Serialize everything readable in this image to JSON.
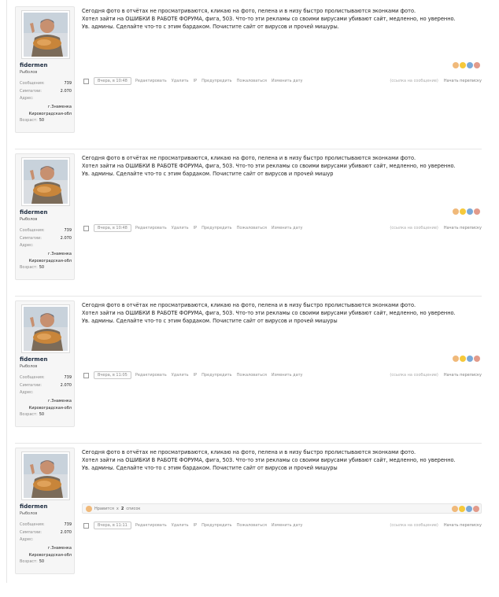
{
  "posts": [
    {
      "user": {
        "name": "fidermen",
        "title": "Рыболов",
        "messages_label": "Сообщения:",
        "messages": "739",
        "sympathy_label": "Симпатии:",
        "sympathy": "2.070",
        "address_label": "Адрес:",
        "address_line1": "г.Знаменка",
        "address_line2": "Кировоградская-обл",
        "age_label": "Возраст:",
        "age": "50"
      },
      "text": [
        "Сегодня фото в отчётах не просматриваются, кликаю на фото, пелена и в низу быстро пролистываются эконками фото.",
        "Хотел зайти на ОШИБКИ В РАБОТЕ ФОРУМА, фига, 503. Что-то эти рекламы со своими вирусами убивают сайт, медленно, но уверенно.",
        "Ув. админы. Сделайте что-то с этим бардаком. Почистите сайт от вирусов и прочей мишуры."
      ],
      "date": "Вчера, в 10:48",
      "likes": null
    },
    {
      "user": {
        "name": "fidermen",
        "title": "Рыболов",
        "messages_label": "Сообщения:",
        "messages": "739",
        "sympathy_label": "Симпатии:",
        "sympathy": "2.070",
        "address_label": "Адрес:",
        "address_line1": "г.Знаменка",
        "address_line2": "Кировоградская-обл",
        "age_label": "Возраст:",
        "age": "50"
      },
      "text": [
        "Сегодня фото в отчётах не просматриваются, кликаю на фото, пелена и в низу быстро пролистываются эконками фото.",
        "Хотел зайти на ОШИБКИ В РАБОТЕ ФОРУМА, фига, 503. Что-то эти рекламы со своими вирусами убивают сайт, медленно, но уверенно.",
        "Ув. админы. Сделайте что-то с этим бардаком. Почистите сайт от вирусов и прочей мишур"
      ],
      "date": "Вчера, в 10:48",
      "likes": null
    },
    {
      "user": {
        "name": "fidermen",
        "title": "Рыболов",
        "messages_label": "Сообщения:",
        "messages": "739",
        "sympathy_label": "Симпатии:",
        "sympathy": "2.070",
        "address_label": "Адрес:",
        "address_line1": "г.Знаменка",
        "address_line2": "Кировоградская-обл",
        "age_label": "Возраст:",
        "age": "50"
      },
      "text": [
        "Сегодня фото в отчётах не просматриваются, кликаю на фото, пелена и в низу быстро пролистываются эконками фото.",
        "Хотел зайти на ОШИБКИ В РАБОТЕ ФОРУМА, фига, 503. Что-то эти рекламы со своими вирусами убивают сайт, медленно, но уверенно.",
        "Ув. админы. Сделайте что-то с этим бардаком. Почистите сайт от вирусов и прочей мишуры"
      ],
      "date": "Вчера, в 11:05",
      "likes": null
    },
    {
      "user": {
        "name": "fidermen",
        "title": "Рыболов",
        "messages_label": "Сообщения:",
        "messages": "739",
        "sympathy_label": "Симпатии:",
        "sympathy": "2.070",
        "address_label": "Адрес:",
        "address_line1": "г.Знаменка",
        "address_line2": "Кировоградская-обл",
        "age_label": "Возраст:",
        "age": "50"
      },
      "text": [
        "Сегодня фото в отчётах не просматриваются, кликаю на фото, пелена и в низу быстро пролистываются эконками фото.",
        "Хотел зайти на ОШИБКИ В РАБОТЕ ФОРУМА, фига, 503. Что-то эти рекламы со своими вирусами убивают сайт, медленно, но уверенно.",
        "Ув. админы. Сделайте что-то с этим бардаком. Почистите сайт от вирусов и прочей мишуры"
      ],
      "date": "Вчера, в 11:11",
      "likes": {
        "label": "Нравится",
        "count_text": "x",
        "count": "2",
        "list": "список"
      }
    }
  ],
  "actions": {
    "edit": "Редактировать",
    "delete": "Удалить",
    "ip": "IP",
    "warn": "Предупредить",
    "report": "Пожаловаться",
    "change_date": "Изменить дату",
    "quote_link": "(ссылка на сообщение)",
    "start_pm": "Начать переписку"
  },
  "reaction_icons": [
    "like-icon",
    "smile-icon",
    "info-icon",
    "dislike-icon"
  ],
  "colors": {
    "like": "#f0b97a",
    "smile": "#f6c93b",
    "info": "#7aa9d8",
    "dislike": "#e29b8b",
    "username": "#1d2c40"
  }
}
